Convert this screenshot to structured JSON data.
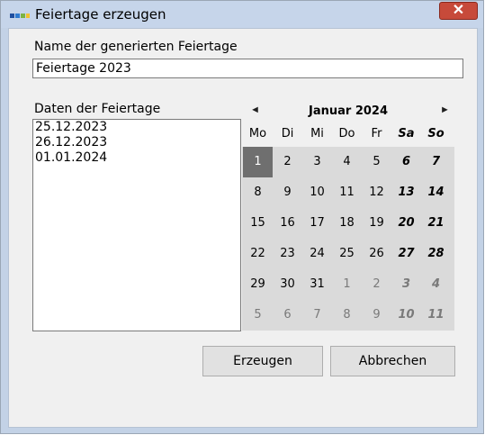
{
  "window": {
    "title": "Feiertage erzeugen",
    "close_symbol": "✕",
    "app_icon": "app-icon",
    "accent_color": "#c74a3a"
  },
  "form": {
    "name_label": "Name der generierten Feiertage",
    "name_value": "Feiertage 2023",
    "dates_label": "Daten der Feiertage",
    "dates": [
      "25.12.2023",
      "26.12.2023",
      "01.01.2024"
    ]
  },
  "calendar": {
    "prev_symbol": "◄",
    "next_symbol": "►",
    "month_label": "Januar 2024",
    "weekdays": [
      "Mo",
      "Di",
      "Mi",
      "Do",
      "Fr",
      "Sa",
      "So"
    ],
    "weeks": [
      [
        "1",
        "2",
        "3",
        "4",
        "5",
        "6",
        "7"
      ],
      [
        "8",
        "9",
        "10",
        "11",
        "12",
        "13",
        "14"
      ],
      [
        "15",
        "16",
        "17",
        "18",
        "19",
        "20",
        "21"
      ],
      [
        "22",
        "23",
        "24",
        "25",
        "26",
        "27",
        "28"
      ],
      [
        "29",
        "30",
        "31",
        "1",
        "2",
        "3",
        "4"
      ],
      [
        "5",
        "6",
        "7",
        "8",
        "9",
        "10",
        "11"
      ]
    ],
    "selected_day": "1"
  },
  "buttons": {
    "create_label": "Erzeugen",
    "cancel_label": "Abbrechen"
  }
}
